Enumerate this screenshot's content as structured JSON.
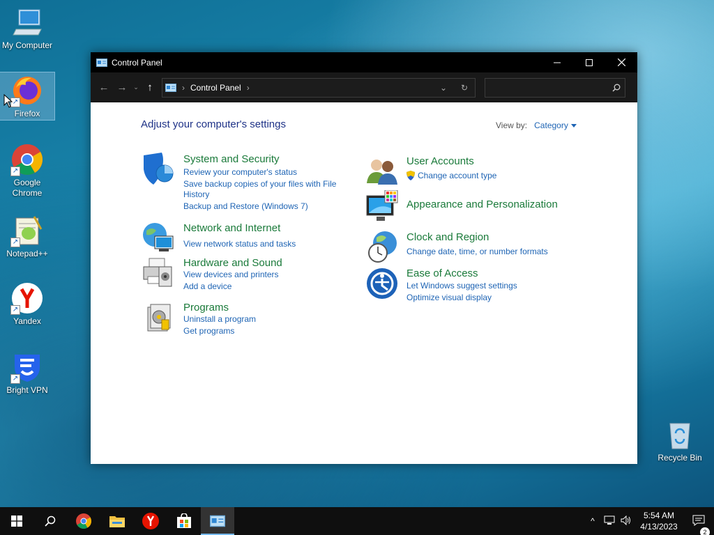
{
  "desktop": {
    "icons": [
      {
        "label": "My Computer"
      },
      {
        "label": "Firefox"
      },
      {
        "label": "Google Chrome"
      },
      {
        "label": "Notepad++"
      },
      {
        "label": "Yandex"
      },
      {
        "label": "Bright VPN"
      }
    ],
    "recycle_bin": "Recycle Bin"
  },
  "window": {
    "title": "Control Panel",
    "address": {
      "crumb": "Control Panel"
    },
    "search": {
      "placeholder": ""
    },
    "heading": "Adjust your computer's settings",
    "view_by_label": "View by:",
    "view_by_value": "Category",
    "categories": [
      {
        "title": "System and Security",
        "icon": "shield-icon",
        "links": [
          "Review your computer's status",
          "Save backup copies of your files with File",
          "History",
          "Backup and Restore (Windows 7)"
        ]
      },
      {
        "title": "Network and Internet",
        "icon": "network-icon",
        "links": [
          "View network status and tasks"
        ]
      },
      {
        "title": "Hardware and Sound",
        "icon": "printer-icon",
        "links": [
          "View devices and printers",
          "Add a device"
        ]
      },
      {
        "title": "Programs",
        "icon": "programs-icon",
        "links": [
          "Uninstall a program",
          "Get programs"
        ]
      },
      {
        "title": "User Accounts",
        "icon": "users-icon",
        "links": [
          "Change account type"
        ]
      },
      {
        "title": "Appearance and Personalization",
        "icon": "monitor-icon",
        "links": []
      },
      {
        "title": "Clock and Region",
        "icon": "clock-globe-icon",
        "links": [
          "Change date, time, or number formats"
        ]
      },
      {
        "title": "Ease of Access",
        "icon": "ease-of-access-icon",
        "links": [
          "Let Windows suggest settings",
          "Optimize visual display"
        ]
      }
    ]
  },
  "taskbar": {
    "time": "5:54 AM",
    "date": "4/13/2023",
    "notifications": "2"
  },
  "colors": {
    "link": "#1e64b4",
    "category_title": "#1a7a3a",
    "heading": "#1e3287"
  }
}
